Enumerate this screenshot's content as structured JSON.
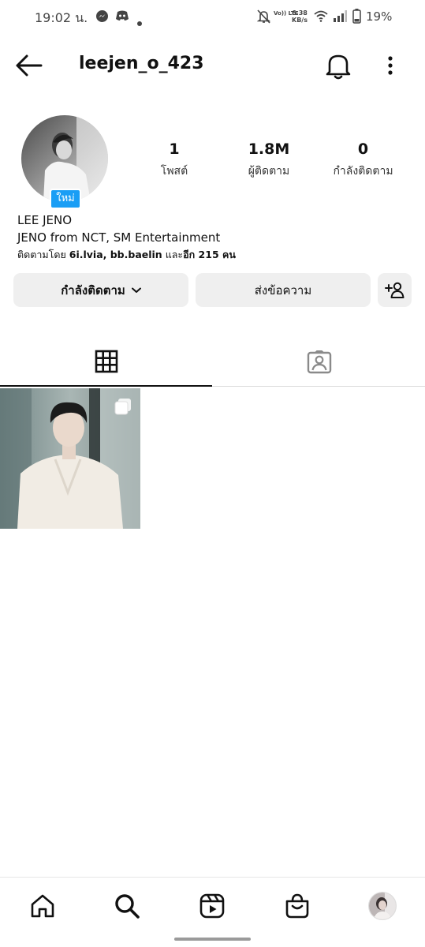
{
  "status_bar": {
    "time": "19:02 น.",
    "volte": "Vo)) LTE",
    "net_speed_value": "6.38",
    "net_speed_unit": "KB/s",
    "battery": "19%",
    "icons": [
      "messenger-icon",
      "discord-icon",
      "dot-icon",
      "mute-icon",
      "wifi-icon",
      "signal-icon",
      "battery-icon"
    ]
  },
  "header": {
    "username": "leejen_o_423",
    "icons": [
      "back-arrow-icon",
      "bell-icon",
      "more-vertical-icon"
    ]
  },
  "profile": {
    "new_badge": "ใหม่",
    "stats": [
      {
        "value": "1",
        "label": "โพสต์"
      },
      {
        "value": "1.8M",
        "label": "ผู้ติดตาม"
      },
      {
        "value": "0",
        "label": "กำลังติดตาม"
      }
    ],
    "display_name": "LEE JENO",
    "bio": "JENO from NCT, SM Entertainment",
    "followed_by_prefix": "ติดตามโดย ",
    "followed_by_names": "6i.lvia, bb.baelin",
    "followed_by_mid": " และ",
    "followed_by_rest": "อีก 215 คน"
  },
  "actions": {
    "following_label": "กำลังติดตาม",
    "message_label": "ส่งข้อความ"
  },
  "tabs": [
    {
      "name": "grid",
      "icon": "grid-icon",
      "active": true
    },
    {
      "name": "tagged",
      "icon": "tagged-person-icon",
      "active": false
    }
  ],
  "posts": [
    {
      "type": "carousel"
    }
  ],
  "bottom_nav": [
    "home-icon",
    "search-icon",
    "reels-icon",
    "shop-icon",
    "profile-avatar"
  ],
  "colors": {
    "badge_blue": "#1a9ef5",
    "button_gray": "#efefef",
    "text": "#111111"
  }
}
